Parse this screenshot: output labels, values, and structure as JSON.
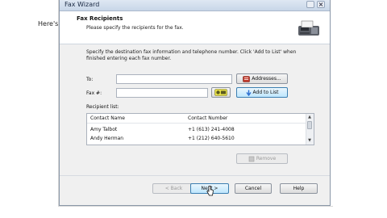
{
  "background": {
    "text": "Here's"
  },
  "window": {
    "title": "Fax Wizard"
  },
  "header": {
    "title": "Fax Recipients",
    "subtitle": "Please specify the recipients for the fax."
  },
  "instructions": "Specify the destination fax information and telephone number. Click 'Add to List' when finished entering each fax number.",
  "form": {
    "to_label": "To:",
    "to_value": "",
    "fax_label": "Fax #:",
    "fax_value": "",
    "addresses_label": "Addresses...",
    "add_to_list_label": "Add to List"
  },
  "recipients": {
    "label": "Recipient list:",
    "columns": [
      "Contact Name",
      "Contact Number"
    ],
    "rows": [
      {
        "name": "Amy Talbot",
        "number": "+1 (613) 241-4008"
      },
      {
        "name": "Andy Herman",
        "number": "+1 (212) 640-5610"
      }
    ],
    "remove_label": "Remove"
  },
  "footer": {
    "back_label": "< Back",
    "next_label": "Next >",
    "cancel_label": "Cancel",
    "help_label": "Help"
  },
  "icons": [
    "fax-machine-icon",
    "address-book-icon",
    "fax-numbers-icon",
    "add-to-list-icon",
    "remove-icon",
    "mouse-cursor-icon"
  ],
  "colors": {
    "accent": "#3c7fb1",
    "header_bg": "#ffffff",
    "dialog_bg": "#f0f0f0"
  }
}
